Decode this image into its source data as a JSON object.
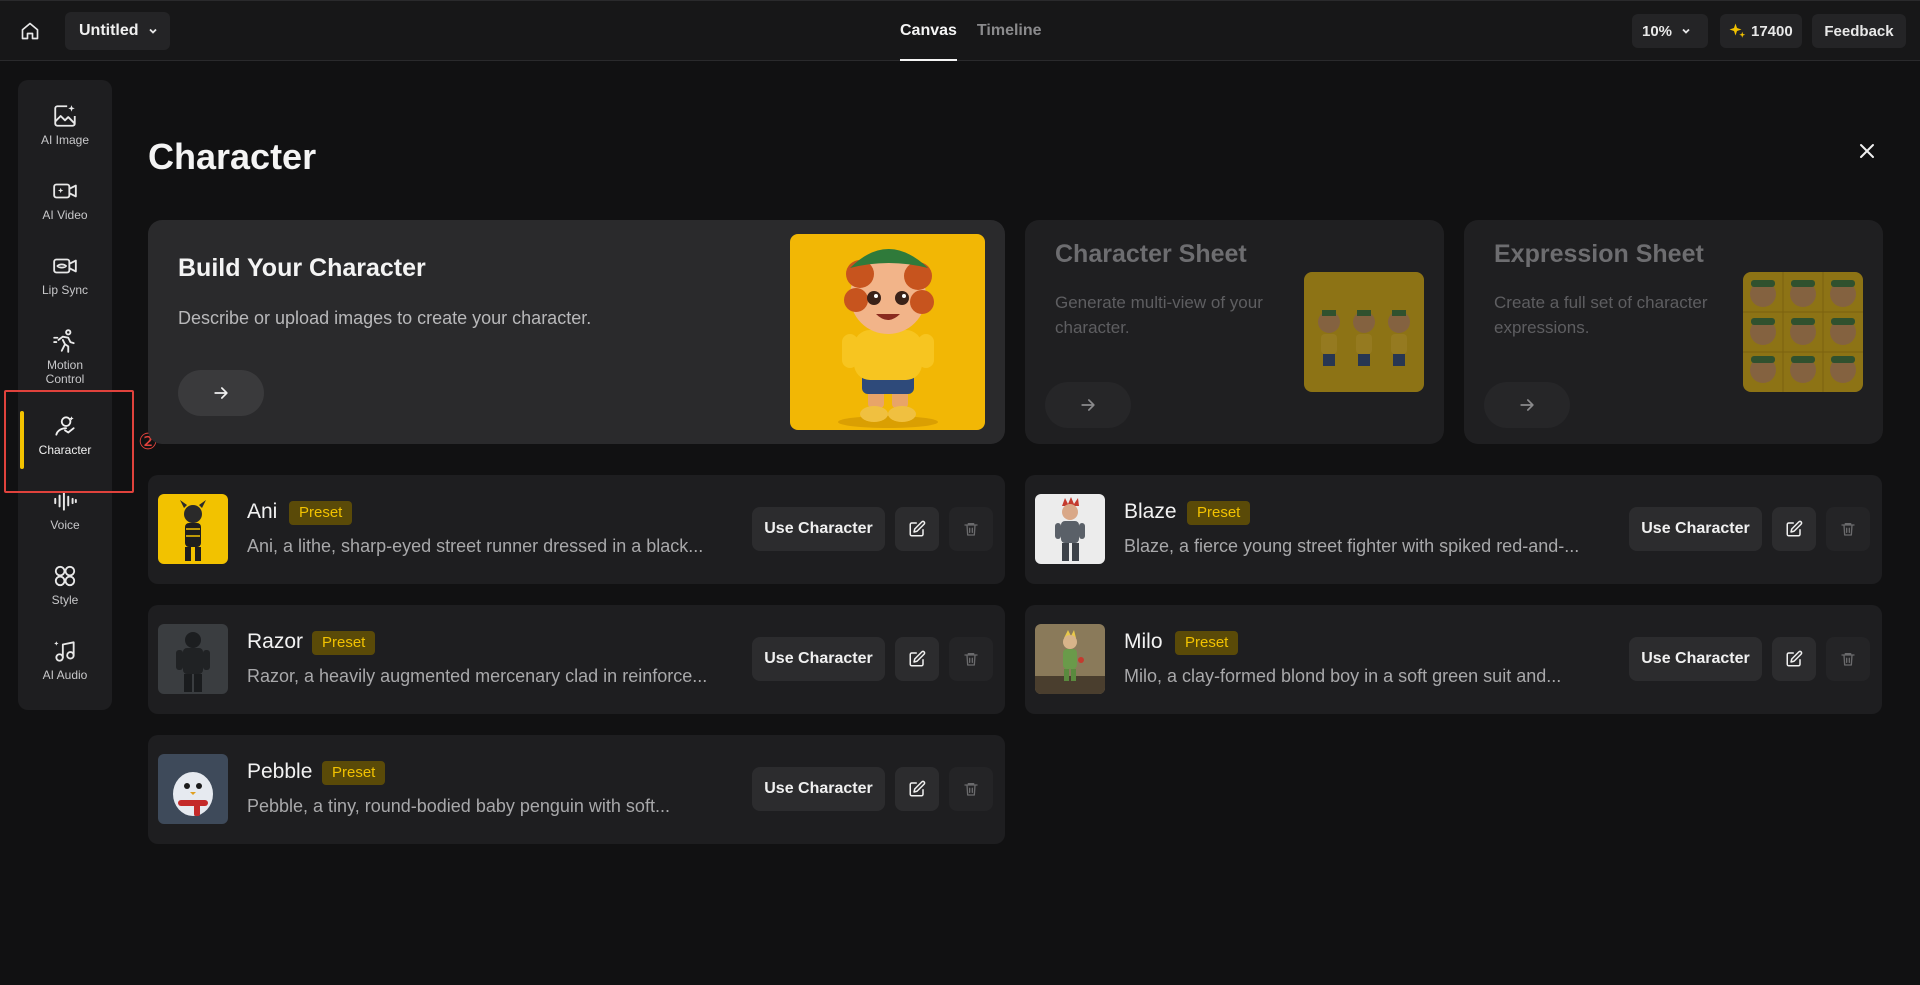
{
  "topbar": {
    "project_name": "Untitled",
    "tabs": [
      {
        "label": "Canvas",
        "active": true
      },
      {
        "label": "Timeline",
        "active": false
      }
    ],
    "zoom": "10%",
    "credits": "17400",
    "feedback_label": "Feedback"
  },
  "sidebar": {
    "items": [
      {
        "label": "AI Image",
        "icon": "image-sparkle-icon"
      },
      {
        "label": "AI Video",
        "icon": "video-sparkle-icon"
      },
      {
        "label": "Lip Sync",
        "icon": "lip-sync-icon"
      },
      {
        "label": "Motion Control",
        "icon": "running-figure-icon"
      },
      {
        "label": "Character",
        "icon": "character-icon",
        "active": true
      },
      {
        "label": "Voice",
        "icon": "waveform-icon"
      },
      {
        "label": "Style",
        "icon": "clover-icon"
      },
      {
        "label": "AI Audio",
        "icon": "music-note-icon"
      }
    ],
    "annotation_marker": "②"
  },
  "main": {
    "title": "Character",
    "build_card": {
      "title": "Build Your Character",
      "description": "Describe or upload images to create your character."
    },
    "sheet_cards": [
      {
        "title": "Character Sheet",
        "description": "Generate multi-view of your character."
      },
      {
        "title": "Expression Sheet",
        "description": "Create a full set of character expressions."
      }
    ],
    "characters": [
      {
        "name": "Ani",
        "badge": "Preset",
        "description": "Ani, a lithe, sharp-eyed street runner dressed in a black..."
      },
      {
        "name": "Blaze",
        "badge": "Preset",
        "description": "Blaze, a fierce young street fighter with spiked red-and-..."
      },
      {
        "name": "Razor",
        "badge": "Preset",
        "description": "Razor, a heavily augmented mercenary clad in reinforce..."
      },
      {
        "name": "Milo",
        "badge": "Preset",
        "description": "Milo, a clay-formed blond boy in a soft green suit and..."
      },
      {
        "name": "Pebble",
        "badge": "Preset",
        "description": "Pebble, a tiny, round-bodied baby penguin with soft..."
      }
    ],
    "use_character_label": "Use Character"
  },
  "colors": {
    "accent": "#f2c200",
    "annotation": "#e0423c",
    "background": "#111112"
  }
}
